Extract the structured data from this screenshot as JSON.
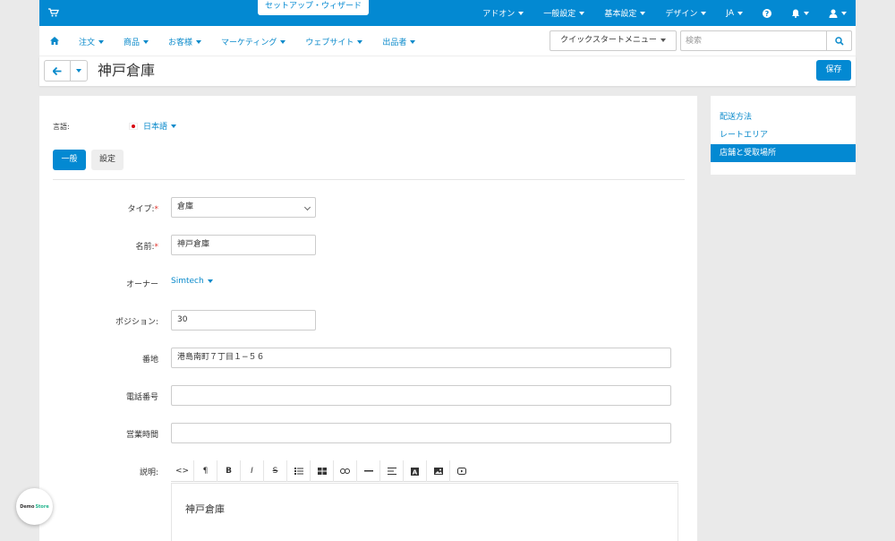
{
  "topbar": {
    "wizard_label": "セットアップ・ウィザード",
    "menu": [
      {
        "label": "アドオン"
      },
      {
        "label": "一般設定"
      },
      {
        "label": "基本設定"
      },
      {
        "label": "デザイン"
      },
      {
        "label": "JA"
      }
    ]
  },
  "nav": {
    "items": [
      {
        "label": "注文"
      },
      {
        "label": "商品"
      },
      {
        "label": "お客様"
      },
      {
        "label": "マーケティング"
      },
      {
        "label": "ウェブサイト"
      },
      {
        "label": "出品者"
      }
    ],
    "quick_menu_label": "クイックスタートメニュー",
    "search_placeholder": "検索"
  },
  "header": {
    "title": "神戸倉庫",
    "save_label": "保存"
  },
  "form": {
    "language_label": "言語:",
    "language_value": "日本語",
    "tabs": {
      "general": "一般",
      "settings": "設定"
    },
    "type_label": "タイプ:",
    "type_value": "倉庫",
    "name_label": "名前:",
    "name_value": "神戸倉庫",
    "owner_label": "オーナー",
    "owner_value": "Simtech",
    "position_label": "ポジション:",
    "position_value": "30",
    "address_label": "番地",
    "address_value": "港島南町７丁目１−５６",
    "phone_label": "電話番号",
    "phone_value": "",
    "hours_label": "営業時間",
    "hours_value": "",
    "description_label": "説明:",
    "description_value": "神戸倉庫"
  },
  "sidebar": {
    "items": [
      {
        "label": "配送方法"
      },
      {
        "label": "レートエリア"
      },
      {
        "label": "店舗と受取場所"
      }
    ]
  },
  "badge": {
    "demo": "Demo",
    "store": "Store"
  },
  "colors": {
    "primary": "#0389d2",
    "link": "#0a8acb",
    "required": "#e0322b",
    "background": "#eaeaea"
  }
}
